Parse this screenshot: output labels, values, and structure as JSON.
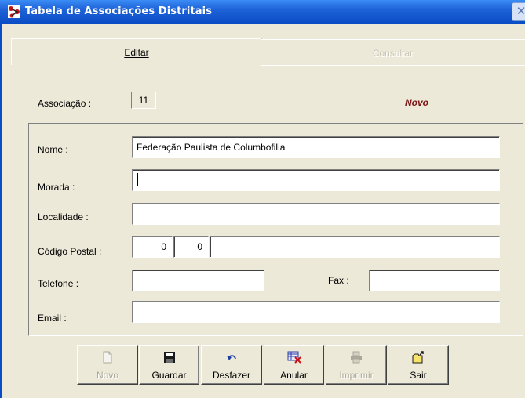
{
  "window": {
    "title": "Tabela de Associações Distritais",
    "close_glyph": "✕"
  },
  "tabs": {
    "editar": "Editar",
    "consultar": "Consultar"
  },
  "form": {
    "associacao_label": "Associação :",
    "associacao_value": "11",
    "status": "Novo",
    "nome_label": "Nome :",
    "nome_value": "Federação Paulista de Columbofilia",
    "morada_label": "Morada :",
    "morada_value": "",
    "localidade_label": "Localidade :",
    "localidade_value": "",
    "codigo_postal_label": "Código Postal :",
    "codigo_postal_1": "0",
    "codigo_postal_2": "0",
    "codigo_postal_3": "",
    "telefone_label": "Telefone :",
    "telefone_value": "",
    "fax_label": "Fax :",
    "fax_value": "",
    "email_label": "Email :",
    "email_value": ""
  },
  "toolbar": {
    "novo": "Novo",
    "guardar": "Guardar",
    "desfazer": "Desfazer",
    "anular": "Anular",
    "imprimir": "Imprimir",
    "sair": "Sair"
  },
  "icons": {
    "novo": "new-document-icon",
    "guardar": "floppy-disk-icon",
    "desfazer": "undo-arrow-icon",
    "anular": "delete-record-icon",
    "imprimir": "printer-icon",
    "sair": "exit-folder-icon"
  },
  "colors": {
    "status": "#7a1515",
    "titlebar": "#0a4cc4",
    "window": "#ece9d8"
  }
}
